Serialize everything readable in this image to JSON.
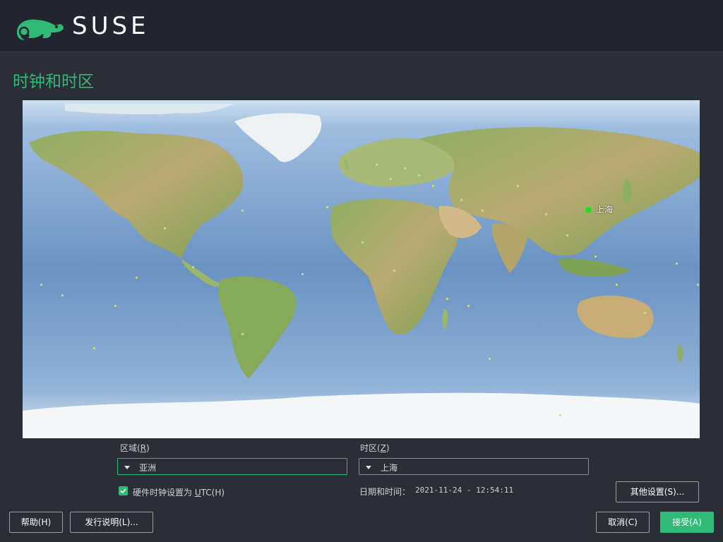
{
  "header": {
    "brand": "SUSE",
    "logo_icon": "chameleon-logo-icon",
    "accent_color": "#30ba78"
  },
  "page": {
    "title": "时钟和时区"
  },
  "map": {
    "selected_city_label": "上海",
    "selected_marker_color": "#22dd22"
  },
  "region": {
    "label_prefix": "区域(",
    "label_key": "R",
    "label_suffix": ")",
    "value": "亚洲"
  },
  "timezone": {
    "label_prefix": "时区(",
    "label_key": "Z",
    "label_suffix": ")",
    "value": "上海"
  },
  "hwclock": {
    "checked": true,
    "label_main": "硬件时钟设置为 ",
    "label_key": "U",
    "label_rest": "TC(H)"
  },
  "datetime": {
    "label": "日期和时间：",
    "value": "2021-11-24 - 12:54:11"
  },
  "buttons": {
    "other_settings": "其他设置(S)...",
    "help": "帮助(H)",
    "release_notes": "发行说明(L)...",
    "cancel": "取消(C)",
    "accept": "接受(A)"
  }
}
